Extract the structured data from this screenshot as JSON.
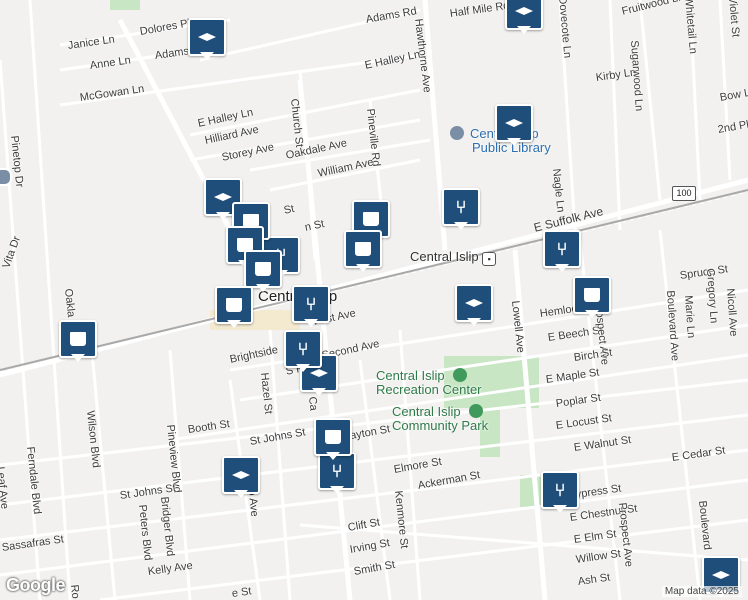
{
  "streets": {
    "adams_rd": "Adams Rd",
    "half_mile_rd": "Half Mile Rd",
    "hawthorne_ave": "Hawthorne Ave",
    "dovecote_ln": "Dovecote Ln",
    "fruitwood_ln": "Fruitwood Ln",
    "whitetail_ln": "Whitetail Ln",
    "violet_st": "Violet St",
    "janice_ln": "Janice Ln",
    "dolores_pl": "Dolores Pl",
    "anne_ln": "Anne Ln",
    "adams_2": "Adams",
    "e_halley_ln_1": "E Halley Ln",
    "kirby_ln": "Kirby Ln",
    "sugarwood_ln": "Sugarwood Ln",
    "mcgowan_ln": "McGowan Ln",
    "bow_ln": "Bow L",
    "e_halley_ln_2": "E Halley Ln",
    "church_st": "Church St",
    "pineville_rd": "Pineville Rd",
    "hilliard_ave": "Hilliard Ave",
    "second_pl": "2nd Pl",
    "storey_ave": "Storey Ave",
    "oakdale_ave": "Oakdale Ave",
    "william_ave": "William Ave",
    "pinetop_dr": "Pinetop Dr",
    "nagle_ln": "Nagle Ln",
    "route_100": "100",
    "e_suffolk_ave": "E Suffolk Ave",
    "st": "St",
    "n_st": "n St",
    "vita_dr": "Vita Dr",
    "oakland": "Oakla",
    "spruce_st": "Spruce St",
    "gregory_ln": "Gregory Ln",
    "nicoll_ave": "Nicoll Ave",
    "marie_ln": "Marie Ln",
    "boulevard_ave": "Boulevard Ave",
    "hemlock": "Hemlock",
    "first_ave": "First Ave",
    "e_beech_st": "E Beech St",
    "brightside": "Brightside",
    "lowell_ave": "Lowell Ave",
    "prospect_ave_1": "Prospect Ave",
    "second_ave": "Second Ave",
    "birch_st": "Birch St",
    "e_maple_st": "E Maple St",
    "s_rd": "S Rd",
    "c_ave": "Ca",
    "hazel_st": "Hazel St",
    "poplar_st": "Poplar St",
    "booth_st": "Booth St",
    "e_locust_st": "E Locust St",
    "e_walnut_st": "E Walnut St",
    "e_cedar_st": "E Cedar St",
    "st_johns_st_1": "St Johns St",
    "clayton_st": "Clayton St",
    "pineview_blvd": "Pineview Blvd",
    "wilson_blvd": "Wilson Blvd",
    "ferndale_blvd": "Ferndale Blvd",
    "leaf_ave": "Leaf Ave",
    "elmore_st": "Elmore St",
    "ackerman_st": "Ackerman St",
    "cypress_st": "Cypress St",
    "st_johns_st_2": "St Johns St",
    "bridger_blvd": "Bridger Blvd",
    "peters_blvd": "Peters Blvd",
    "lo_ave": "llo Ave",
    "e_chestnut_st": "E Chestnut St",
    "kenmore_st": "Kenmore St",
    "e_elm_st": "E Elm St",
    "sassafras_st": "Sassafras St",
    "clift_st": "Clift St",
    "irving_st": "Irving St",
    "willow_st": "Willow St",
    "kelly_ave": "Kelly Ave",
    "smith_st": "Smith St",
    "ash_st": "Ash St",
    "prospect_ave_2": "Prospect Ave",
    "boulevard_2": "Boulevard",
    "e_st": "e St",
    "rd": "Ro"
  },
  "places": {
    "library_line1": "Central Islip",
    "library_line2": "Public Library",
    "station": "Central Islip",
    "town": "Central Islip",
    "recreation_line1": "Central Islip",
    "recreation_line2": "Recreation Center",
    "park_line1": "Central Islip",
    "park_line2": "Community Park"
  },
  "markers": [
    {
      "type": "school"
    },
    {
      "type": "school"
    },
    {
      "type": "school"
    },
    {
      "type": "school"
    },
    {
      "type": "school"
    },
    {
      "type": "school"
    },
    {
      "type": "school"
    },
    {
      "type": "school"
    },
    {
      "type": "restaurant"
    },
    {
      "type": "restaurant"
    },
    {
      "type": "restaurant"
    },
    {
      "type": "restaurant"
    },
    {
      "type": "restaurant"
    },
    {
      "type": "restaurant"
    },
    {
      "type": "restaurant"
    },
    {
      "type": "shopping"
    },
    {
      "type": "shopping"
    },
    {
      "type": "shopping"
    },
    {
      "type": "shopping"
    },
    {
      "type": "shopping"
    },
    {
      "type": "shopping"
    },
    {
      "type": "shopping"
    },
    {
      "type": "shopping"
    }
  ],
  "icons": {
    "school": "graduation-cap-icon",
    "restaurant": "fork-knife-icon",
    "shopping": "shopping-bag-icon",
    "library": "library-icon",
    "train": "train-icon",
    "park": "park-icon",
    "recreation": "recreation-icon"
  },
  "colors": {
    "marker_fill": "#1e4e79",
    "park_green": "#c8e6c4",
    "rail": "#a9a9a9",
    "map_background": "#f2f1ef"
  },
  "branding": {
    "logo": "Google",
    "attribution": "Map data ©2025"
  }
}
